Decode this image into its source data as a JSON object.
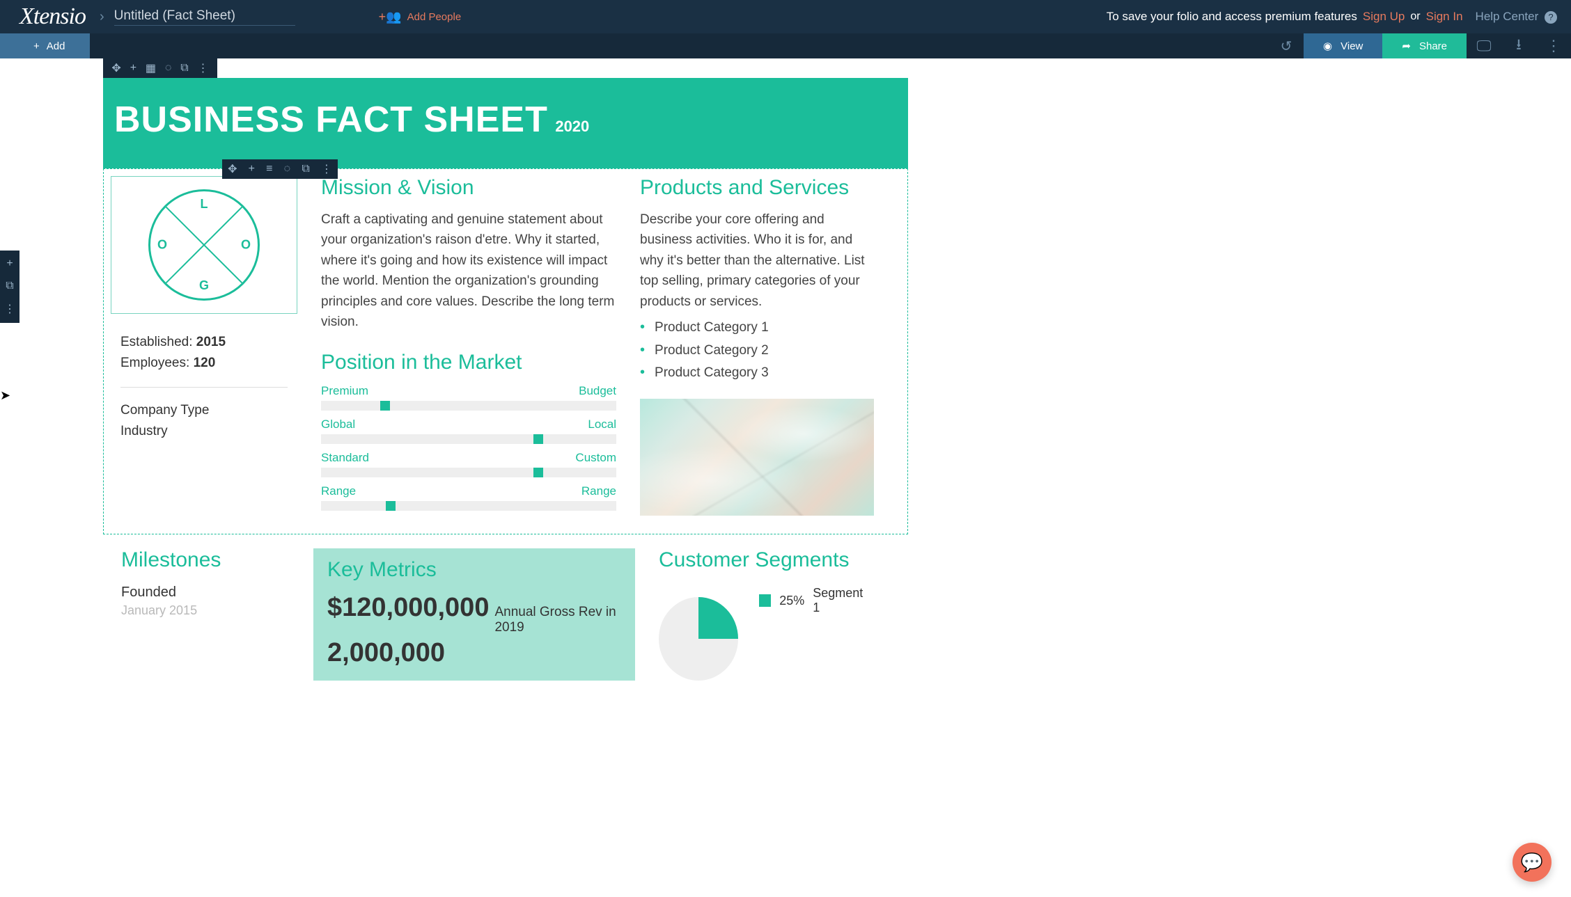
{
  "topbar": {
    "logo": "Xtensio",
    "doc_title": "Untitled (Fact Sheet)",
    "add_people": "Add People",
    "info": "To save your folio and access premium features",
    "signup": "Sign Up",
    "or": "or",
    "signin": "Sign In",
    "help": "Help Center"
  },
  "secondbar": {
    "add": "Add",
    "view": "View",
    "share": "Share"
  },
  "banner": {
    "title": "BUSINESS FACT SHEET",
    "year": "2020"
  },
  "company": {
    "established_label": "Established:",
    "established_value": "2015",
    "employees_label": "Employees:",
    "employees_value": "120",
    "type": "Company Type",
    "industry": "Industry"
  },
  "mission": {
    "heading": "Mission & Vision",
    "body": "Craft a captivating and genuine statement about your organization's raison d'etre. Why it started, where it's going and how its existence will impact the world. Mention the organization's grounding principles and core values. Describe the long term vision."
  },
  "position": {
    "heading": "Position in the Market",
    "sliders": [
      {
        "left": "Premium",
        "right": "Budget",
        "pct": 20
      },
      {
        "left": "Global",
        "right": "Local",
        "pct": 72
      },
      {
        "left": "Standard",
        "right": "Custom",
        "pct": 72
      },
      {
        "left": "Range",
        "right": "Range",
        "pct": 22
      }
    ]
  },
  "products": {
    "heading": "Products and Services",
    "body": "Describe your core offering and business activities. Who it is for, and why it's better than the alternative. List top selling, primary categories of your products or services.",
    "items": [
      "Product Category 1",
      "Product Category 2",
      "Product Category 3"
    ]
  },
  "milestones": {
    "heading": "Milestones",
    "items": [
      {
        "title": "Founded",
        "date": "January 2015"
      }
    ]
  },
  "metrics": {
    "heading": "Key Metrics",
    "items": [
      {
        "value": "$120,000,000",
        "desc": "Annual Gross Rev in 2019"
      },
      {
        "value": "2,000,000",
        "desc": ""
      }
    ]
  },
  "segments": {
    "heading": "Customer Segments",
    "items": [
      {
        "pct": "25%",
        "label": "Segment 1"
      }
    ]
  },
  "logo_letters": {
    "top": "L",
    "left": "O",
    "right": "O",
    "bottom": "G"
  },
  "chart_data": {
    "type": "pie",
    "title": "Customer Segments",
    "series": [
      {
        "name": "Segment 1",
        "value": 25
      }
    ]
  }
}
